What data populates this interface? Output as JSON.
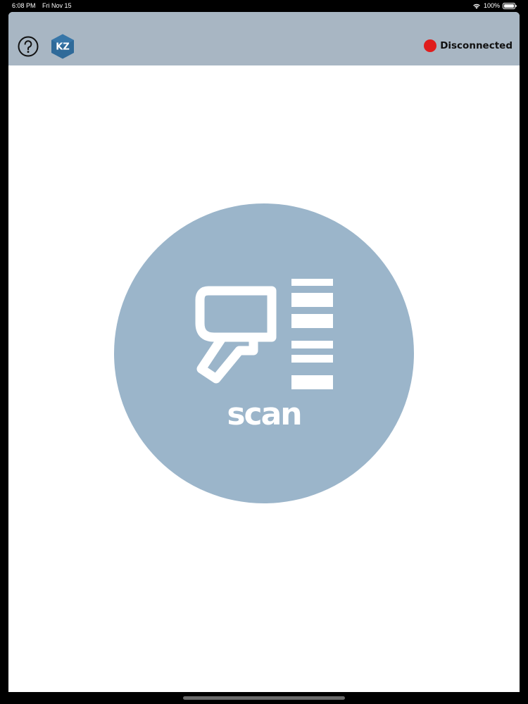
{
  "status_bar": {
    "time": "6:08 PM",
    "date": "Fri Nov 15",
    "battery": "100%",
    "icons": [
      "wifi-icon",
      "battery-icon"
    ]
  },
  "header": {
    "help_icon": "question-mark-circle-icon",
    "logo_text": "KZ",
    "connection": {
      "status": "Disconnected",
      "status_color": "#e01c1c"
    },
    "background_color": "#a8b6c3"
  },
  "main": {
    "scan_button": {
      "label": "scan",
      "icon": "barcode-scanner-icon",
      "color": "#9bb5ca"
    }
  }
}
